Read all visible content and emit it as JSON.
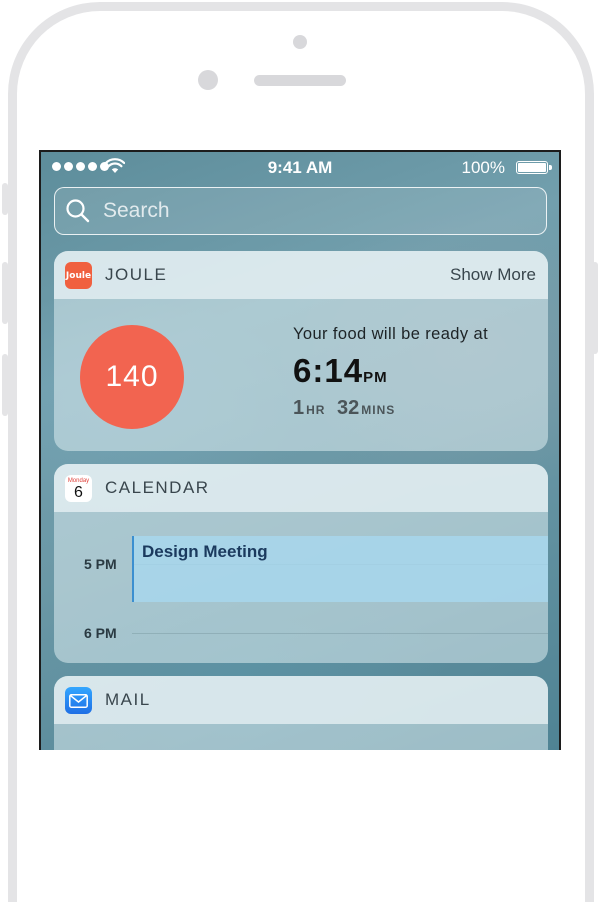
{
  "status_bar": {
    "time": "9:41 AM",
    "battery": "100%",
    "signal_icon": "signal-dots-icon",
    "wifi_icon": "wifi-icon",
    "battery_icon": "battery-icon"
  },
  "search": {
    "placeholder": "Search",
    "icon": "search-icon"
  },
  "widgets": {
    "joule": {
      "icon_label": "Joule",
      "title": "JOULE",
      "show_more": "Show More",
      "temperature": "140",
      "message": "Your food will be ready at",
      "ready_time": "6:14",
      "ready_ampm": "PM",
      "hours_value": "1",
      "hours_unit": "HR",
      "mins_value": "32",
      "mins_unit": "MINS"
    },
    "calendar": {
      "icon_day_of_week": "Monday",
      "icon_day_number": "6",
      "title": "CALENDAR",
      "hours": [
        "5 PM",
        "6 PM"
      ],
      "event_title": "Design Meeting"
    },
    "mail": {
      "title": "MAIL",
      "icon": "envelope-icon"
    }
  },
  "colors": {
    "joule_accent": "#f26450",
    "calendar_event": "#a8d8f0",
    "calendar_event_bar": "#3b8fd0",
    "mail_accent": "#1f6fe5"
  }
}
